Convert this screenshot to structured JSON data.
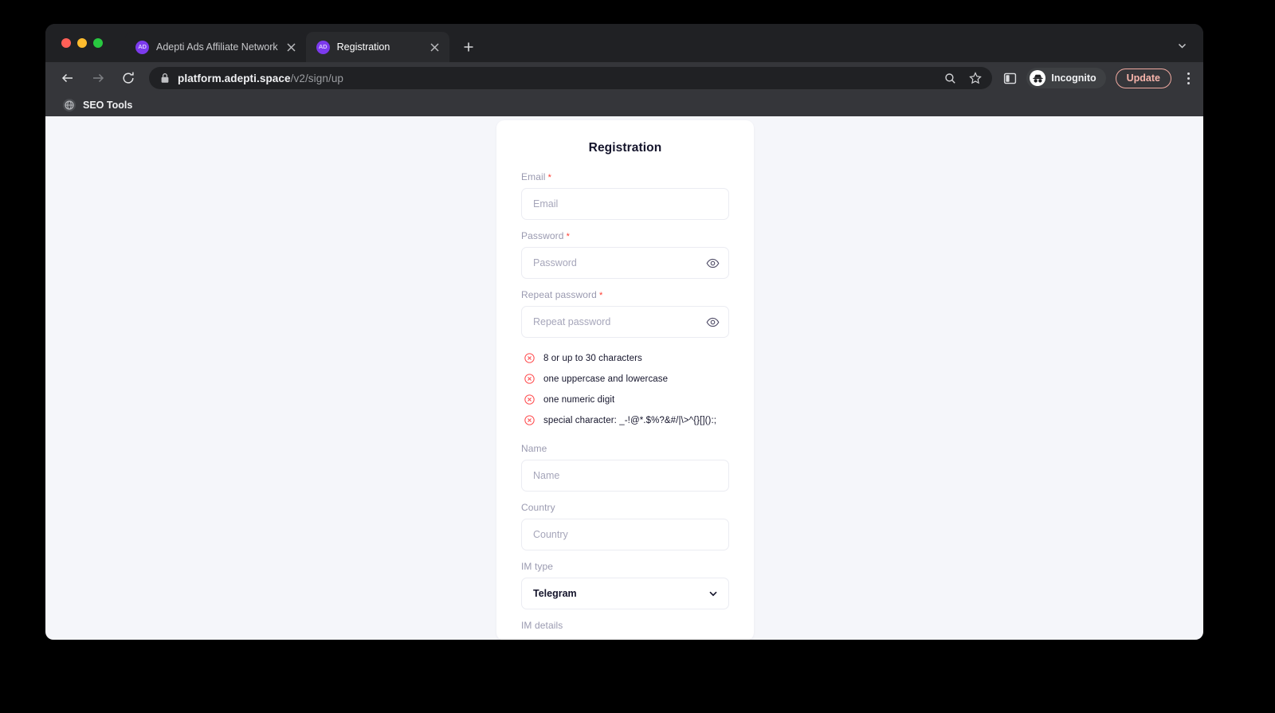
{
  "browser": {
    "tabs": [
      {
        "title": "Adepti Ads Affiliate Network",
        "favicon_text": "AD",
        "favicon_name": "adepti-favicon",
        "active": false
      },
      {
        "title": "Registration",
        "favicon_text": "AD",
        "favicon_name": "adepti-favicon",
        "active": true
      }
    ],
    "new_tab_label": "+",
    "omnibox": {
      "url_domain": "platform.adepti.space",
      "url_path": "/v2/sign/up",
      "lock_icon": "lock-icon",
      "search_icon": "search-icon",
      "bookmark_icon": "star-icon"
    },
    "toolbar": {
      "back_icon": "arrow-left-icon",
      "forward_icon": "arrow-right-icon",
      "reload_icon": "reload-icon",
      "side_panel_icon": "side-panel-icon",
      "profile_label": "Incognito",
      "profile_icon": "incognito-icon",
      "update_label": "Update",
      "menu_icon": "more-vertical-icon",
      "window_chevron_icon": "chevron-down-icon"
    },
    "bookmarks": [
      {
        "label": "SEO Tools",
        "icon": "globe-icon"
      }
    ],
    "accents": {
      "favicon_purple": "#7c3aed",
      "update_border": "#f0a9a0",
      "update_text": "#f6b4ab",
      "tab_strip_bg": "#202124",
      "toolbar_bg": "#35363a",
      "active_tab_bg": "#292a2d"
    }
  },
  "page": {
    "background": "#f5f6fa",
    "card": {
      "title": "Registration",
      "fields": [
        {
          "label": "Email",
          "required": true,
          "placeholder": "Email",
          "value": "",
          "type": "email",
          "name": "email-field"
        },
        {
          "label": "Password",
          "required": true,
          "placeholder": "Password",
          "value": "",
          "type": "password",
          "name": "password-field",
          "toggle_icon": "eye-icon"
        },
        {
          "label": "Repeat password",
          "required": true,
          "placeholder": "Repeat password",
          "value": "",
          "type": "password",
          "name": "repeat-password-field",
          "toggle_icon": "eye-icon"
        }
      ],
      "password_requirements": {
        "status_icon": "circle-x-icon",
        "status_color": "#ff4d4f",
        "items": [
          "8 or up to 30 characters",
          "one uppercase and lowercase",
          "one numeric digit",
          "special character: _-!@*.$%?&#/|\\>^{}[]():;"
        ]
      },
      "name_field": {
        "label": "Name",
        "placeholder": "Name",
        "value": ""
      },
      "country_field": {
        "label": "Country",
        "placeholder": "Country",
        "value": ""
      },
      "im_type_field": {
        "label": "IM type",
        "value": "Telegram",
        "chevron_icon": "chevron-down-icon"
      },
      "im_details_label": "IM details"
    }
  }
}
